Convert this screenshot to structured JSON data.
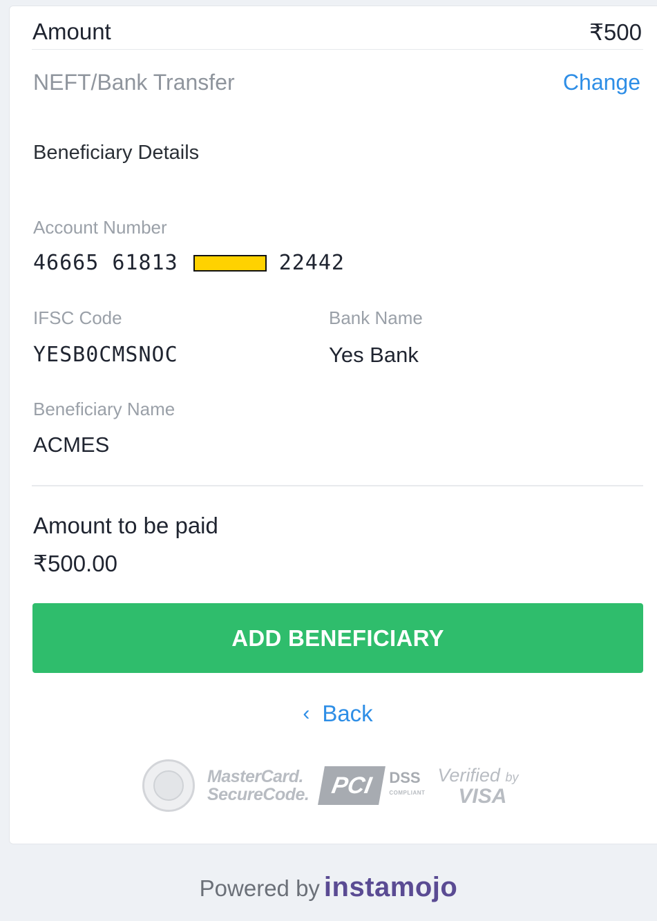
{
  "summary": {
    "amount_label": "Amount",
    "amount_value": "₹500",
    "method_label": "NEFT/Bank Transfer",
    "change_label": "Change"
  },
  "beneficiary": {
    "section_title": "Beneficiary Details",
    "account_number_label": "Account Number",
    "account_number_part1": "46665 61813",
    "account_number_part3": "22442",
    "ifsc_label": "IFSC Code",
    "ifsc_value": "YESB0CMSNOC",
    "bank_name_label": "Bank Name",
    "bank_name_value": "Yes Bank",
    "beneficiary_name_label": "Beneficiary Name",
    "beneficiary_name_value": "ACMES"
  },
  "payment": {
    "amount_to_pay_label": "Amount to be paid",
    "amount_to_pay_value": "₹500.00"
  },
  "actions": {
    "add_beneficiary_label": "ADD BENEFICIARY",
    "back_label": "Back"
  },
  "badges": {
    "mastercard_line1": "MasterCard.",
    "mastercard_line2": "SecureCode.",
    "pci_label": "PCI",
    "dss_label": "DSS",
    "dss_sub": "COMPLIANT",
    "visa_line1": "Verified",
    "visa_by": "by",
    "visa_line2": "VISA"
  },
  "footer": {
    "powered_by": "Powered by",
    "brand": "instamojo"
  },
  "colors": {
    "primary_green": "#2fbd6c",
    "link_blue": "#2e8ee6",
    "brand_purple": "#5a4b93",
    "redaction_yellow": "#ffd200"
  }
}
